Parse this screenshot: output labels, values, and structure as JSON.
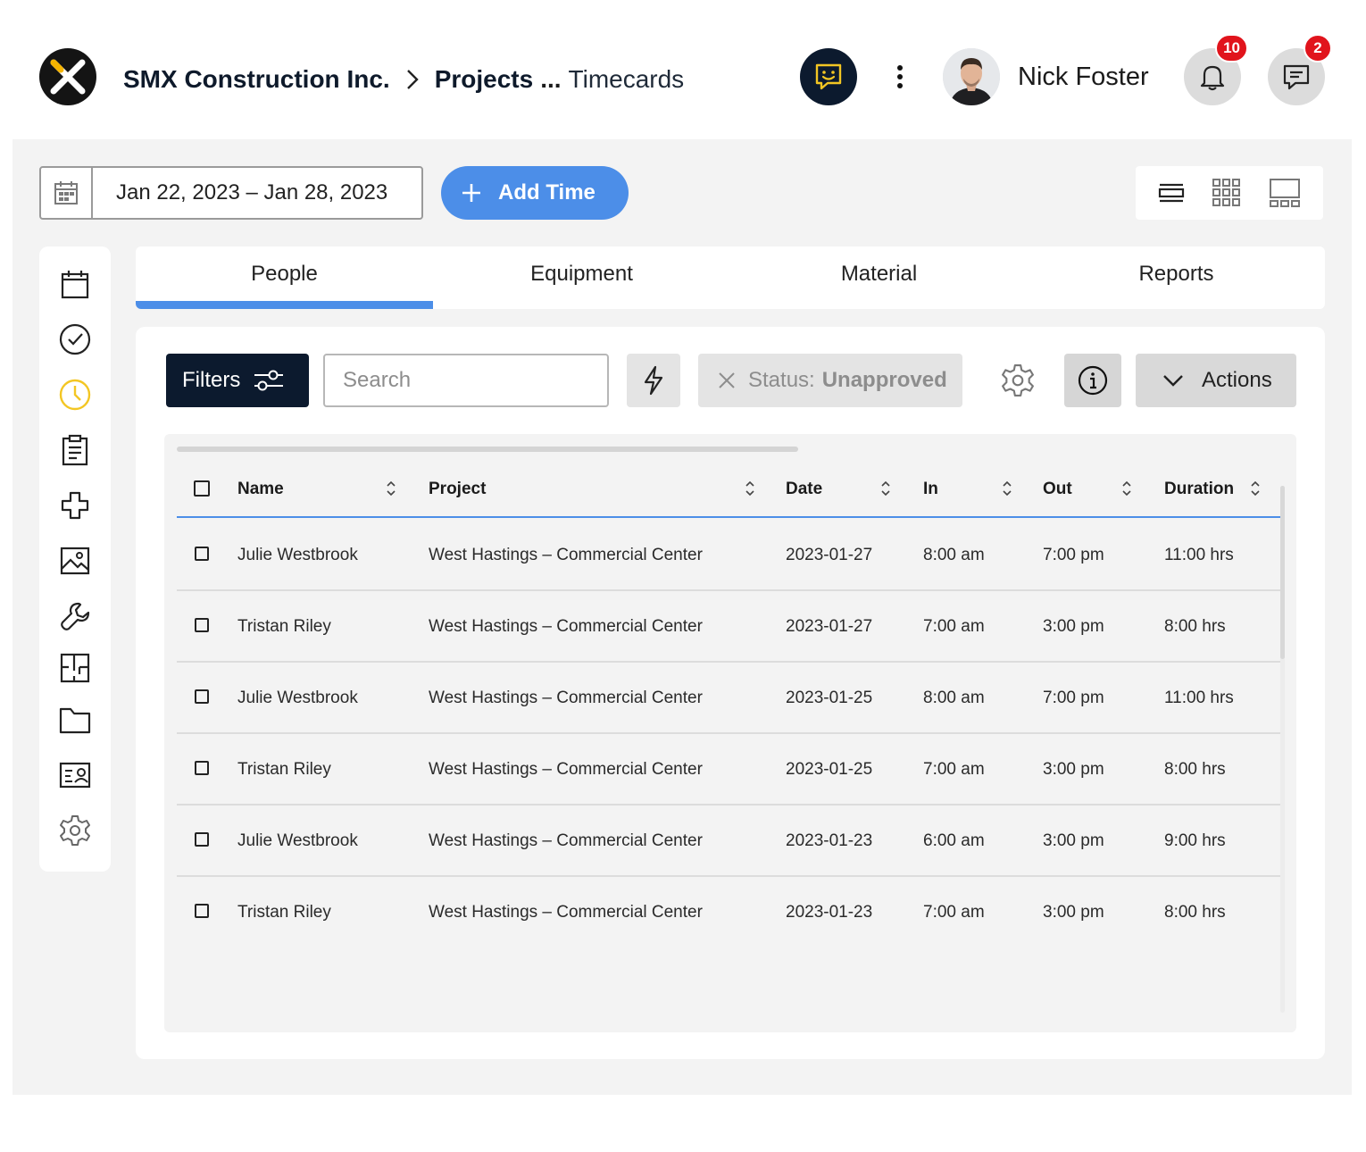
{
  "header": {
    "company": "SMX Construction Inc.",
    "section": "Projects",
    "ellipsis": "...",
    "current": "Timecards",
    "user_name": "Nick Foster",
    "notifications_count": "10",
    "messages_count": "2"
  },
  "toolbar": {
    "date_range": "Jan 22, 2023 – Jan 28, 2023",
    "add_time_label": "Add Time"
  },
  "tabs": [
    {
      "label": "People",
      "active": true
    },
    {
      "label": "Equipment",
      "active": false
    },
    {
      "label": "Material",
      "active": false
    },
    {
      "label": "Reports",
      "active": false
    }
  ],
  "filters": {
    "filters_label": "Filters",
    "search_placeholder": "Search",
    "status_prefix": "Status:",
    "status_value": "Unapproved",
    "actions_label": "Actions"
  },
  "table": {
    "columns": [
      "Name",
      "Project",
      "Date",
      "In",
      "Out",
      "Duration"
    ],
    "rows": [
      [
        "Julie Westbrook",
        "West Hastings – Commercial Center",
        "2023-01-27",
        "8:00 am",
        "7:00 pm",
        "11:00 hrs"
      ],
      [
        "Tristan Riley",
        "West Hastings – Commercial Center",
        "2023-01-27",
        "7:00 am",
        "3:00 pm",
        "8:00 hrs"
      ],
      [
        "Julie Westbrook",
        "West Hastings – Commercial Center",
        "2023-01-25",
        "8:00 am",
        "7:00 pm",
        "11:00 hrs"
      ],
      [
        "Tristan Riley",
        "West Hastings – Commercial Center",
        "2023-01-25",
        "7:00 am",
        "3:00 pm",
        "8:00 hrs"
      ],
      [
        "Julie Westbrook",
        "West Hastings – Commercial Center",
        "2023-01-23",
        "6:00 am",
        "3:00 pm",
        "9:00 hrs"
      ],
      [
        "Tristan Riley",
        "West Hastings – Commercial Center",
        "2023-01-23",
        "7:00 am",
        "3:00 pm",
        "8:00 hrs"
      ]
    ]
  },
  "colors": {
    "accent": "#4c8ee8",
    "navy": "#0c1a2e",
    "badge": "#e1141c",
    "clock_active": "#f3c623",
    "logo_accent": "#f5b400"
  },
  "sidebar": {
    "icons": [
      "calendar-icon",
      "check-circle-icon",
      "clock-icon",
      "clipboard-icon",
      "medical-cross-icon",
      "image-icon",
      "wrench-icon",
      "floorplan-icon",
      "folder-icon",
      "id-card-icon",
      "gear-icon"
    ]
  }
}
